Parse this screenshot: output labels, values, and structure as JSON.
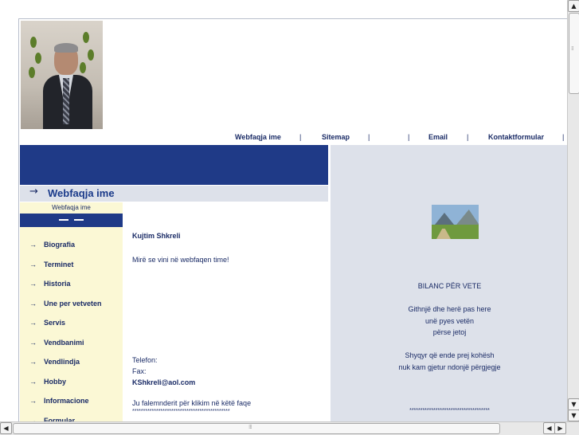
{
  "topnav": {
    "links": [
      "Webfaqja ime",
      "Sitemap",
      "",
      "Email",
      "Kontaktformular"
    ],
    "separator": "|"
  },
  "page": {
    "title": "Webfaqja ime"
  },
  "sidebar": {
    "breadcrumb": "Webfaqja ime",
    "items": [
      "Biografia",
      "Terminet",
      "Historia",
      "Une per vetveten",
      "Servis",
      "Vendbanimi",
      "Vendlindja",
      "Hobby",
      "Informacione",
      "Formular"
    ]
  },
  "content": {
    "name": "Kujtim Shkreli",
    "welcome": "Mirë se vini në webfaqen time!",
    "phone_label": "Telefon:",
    "fax_label": "Fax:",
    "email": "KShkreli@aol.com",
    "thanks": "Ju falemnderit për klikim në këtë faqe",
    "stars": "*********************************************"
  },
  "poem": {
    "title": "BILANC PËR VETE",
    "lines": [
      "Githnjë dhe herë pas here",
      "unë pyes vetën",
      "përse jetoj",
      "Shyqyr që ende prej kohësh",
      "nuk kam gjetur ndonjë përgjegje"
    ],
    "stars": "*************************************"
  },
  "icons": {
    "arrow": "→",
    "scroll_up": "▲",
    "scroll_down": "▼",
    "scroll_left": "◀",
    "scroll_right": "▶"
  },
  "colors": {
    "navy": "#1f3a87",
    "panel": "#dde1ea",
    "sidebar": "#fbf8d5",
    "text": "#1a2b66"
  }
}
